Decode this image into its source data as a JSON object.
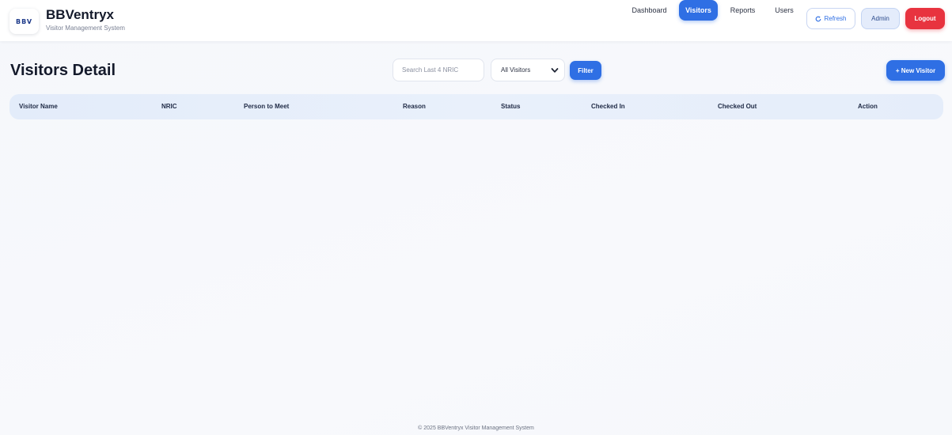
{
  "brand": {
    "logo_text": "BBV",
    "title": "BBVentryx",
    "subtitle": "Visitor Management System"
  },
  "nav": {
    "items": [
      {
        "label": "Dashboard",
        "active": false
      },
      {
        "label": "Visitors",
        "active": true
      },
      {
        "label": "Reports",
        "active": false
      },
      {
        "label": "Users",
        "active": false
      }
    ],
    "refresh_label": "Refresh",
    "admin_label": "Admin",
    "logout_label": "Logout"
  },
  "page": {
    "title": "Visitors Detail",
    "search_placeholder": "Search Last 4 NRIC",
    "filter_select_value": "All Visitors",
    "filter_button_label": "Filter",
    "new_visitor_label": "+ New Visitor"
  },
  "table": {
    "columns": [
      "Visitor Name",
      "NRIC",
      "Person to Meet",
      "Reason",
      "Status",
      "Checked In",
      "Checked Out",
      "Action"
    ],
    "rows": []
  },
  "footer": {
    "text": "© 2025 BBVentryx Visitor Management System"
  },
  "colors": {
    "accent": "#2f6fe4",
    "danger": "#e8333f",
    "admin_bg": "#e4ecfb",
    "table_header_bg": "#e6eefa"
  }
}
